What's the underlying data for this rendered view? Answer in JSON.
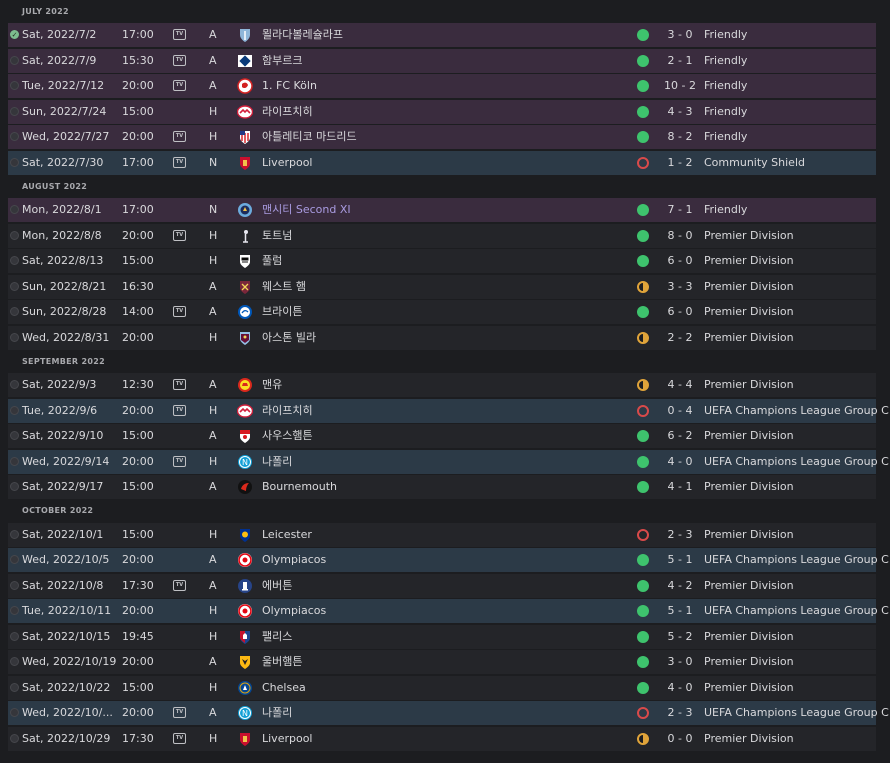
{
  "colors": {
    "background": "#1c1d20",
    "row": "#242529",
    "row_friendly": "#3a2c3e",
    "row_europe": "#2c3a47",
    "win": "#3ec36d",
    "draw": "#e0a43a",
    "loss": "#d94a4a",
    "accent_link": "#a99be0"
  },
  "tv_label": "TV",
  "months": [
    {
      "label": "JULY 2022",
      "matches": [
        {
          "date": "Sat, 2022/7/2",
          "time": "17:00",
          "tv": true,
          "venue": "A",
          "crest": "crest-malmo-icon",
          "opponent": "묄라다볼레슐라프",
          "result": "win",
          "score": "3 - 0",
          "competition": "Friendly",
          "kind": "friendly",
          "check": "done"
        },
        {
          "date": "Sat, 2022/7/9",
          "time": "15:30",
          "tv": true,
          "venue": "A",
          "crest": "crest-hamburg-icon",
          "opponent": "함부르크",
          "result": "win",
          "score": "2 - 1",
          "competition": "Friendly",
          "kind": "friendly",
          "check": "empty"
        },
        {
          "date": "Tue, 2022/7/12",
          "time": "20:00",
          "tv": true,
          "venue": "A",
          "crest": "crest-koln-icon",
          "opponent": "1. FC Köln",
          "result": "win",
          "score": "10 - 2",
          "competition": "Friendly",
          "kind": "friendly",
          "check": "empty"
        },
        {
          "date": "Sun, 2022/7/24",
          "time": "15:00",
          "tv": false,
          "venue": "H",
          "crest": "crest-leipzig-icon",
          "opponent": "라이프치히",
          "result": "win",
          "score": "4 - 3",
          "competition": "Friendly",
          "kind": "friendly",
          "check": "empty"
        },
        {
          "date": "Wed, 2022/7/27",
          "time": "20:00",
          "tv": true,
          "venue": "H",
          "crest": "crest-atletico-icon",
          "opponent": "아틀레티코 마드리드",
          "result": "win",
          "score": "8 - 2",
          "competition": "Friendly",
          "kind": "friendly",
          "check": "empty"
        },
        {
          "date": "Sat, 2022/7/30",
          "time": "17:00",
          "tv": true,
          "venue": "N",
          "crest": "crest-liverpool-icon",
          "opponent": "Liverpool",
          "result": "loss",
          "score": "1 - 2",
          "competition": "Community Shield",
          "kind": "europe",
          "check": "empty"
        }
      ]
    },
    {
      "label": "AUGUST 2022",
      "matches": [
        {
          "date": "Mon, 2022/8/1",
          "time": "17:00",
          "tv": false,
          "venue": "N",
          "crest": "crest-mancity-icon",
          "opponent": "맨시티 Second XI",
          "result": "win",
          "score": "7 - 1",
          "competition": "Friendly",
          "kind": "friendly",
          "check": "empty",
          "special": true
        },
        {
          "date": "Mon, 2022/8/8",
          "time": "20:00",
          "tv": true,
          "venue": "H",
          "crest": "crest-tottenham-icon",
          "opponent": "토트넘",
          "result": "win",
          "score": "8 - 0",
          "competition": "Premier Division",
          "kind": "league",
          "check": "empty"
        },
        {
          "date": "Sat, 2022/8/13",
          "time": "15:00",
          "tv": false,
          "venue": "H",
          "crest": "crest-fulham-icon",
          "opponent": "풀럼",
          "result": "win",
          "score": "6 - 0",
          "competition": "Premier Division",
          "kind": "league",
          "check": "empty"
        },
        {
          "date": "Sun, 2022/8/21",
          "time": "16:30",
          "tv": false,
          "venue": "A",
          "crest": "crest-westham-icon",
          "opponent": "웨스트 햄",
          "result": "draw",
          "score": "3 - 3",
          "competition": "Premier Division",
          "kind": "league",
          "check": "empty"
        },
        {
          "date": "Sun, 2022/8/28",
          "time": "14:00",
          "tv": true,
          "venue": "A",
          "crest": "crest-brighton-icon",
          "opponent": "브라이튼",
          "result": "win",
          "score": "6 - 0",
          "competition": "Premier Division",
          "kind": "league",
          "check": "empty"
        },
        {
          "date": "Wed, 2022/8/31",
          "time": "20:00",
          "tv": false,
          "venue": "H",
          "crest": "crest-villa-icon",
          "opponent": "아스톤 빌라",
          "result": "draw",
          "score": "2 - 2",
          "competition": "Premier Division",
          "kind": "league",
          "check": "empty"
        }
      ]
    },
    {
      "label": "SEPTEMBER 2022",
      "matches": [
        {
          "date": "Sat, 2022/9/3",
          "time": "12:30",
          "tv": true,
          "venue": "A",
          "crest": "crest-manutd-icon",
          "opponent": "맨유",
          "result": "draw",
          "score": "4 - 4",
          "competition": "Premier Division",
          "kind": "league",
          "check": "empty"
        },
        {
          "date": "Tue, 2022/9/6",
          "time": "20:00",
          "tv": true,
          "venue": "H",
          "crest": "crest-leipzig-icon",
          "opponent": "라이프치히",
          "result": "loss",
          "score": "0 - 4",
          "competition": "UEFA Champions League Group C",
          "kind": "europe",
          "check": "empty"
        },
        {
          "date": "Sat, 2022/9/10",
          "time": "15:00",
          "tv": false,
          "venue": "A",
          "crest": "crest-southampton-icon",
          "opponent": "사우스햄튼",
          "result": "win",
          "score": "6 - 2",
          "competition": "Premier Division",
          "kind": "league",
          "check": "empty"
        },
        {
          "date": "Wed, 2022/9/14",
          "time": "20:00",
          "tv": true,
          "venue": "H",
          "crest": "crest-napoli-icon",
          "opponent": "나폴리",
          "result": "win",
          "score": "4 - 0",
          "competition": "UEFA Champions League Group C",
          "kind": "europe",
          "check": "empty"
        },
        {
          "date": "Sat, 2022/9/17",
          "time": "15:00",
          "tv": false,
          "venue": "A",
          "crest": "crest-bournemouth-icon",
          "opponent": "Bournemouth",
          "result": "win",
          "score": "4 - 1",
          "competition": "Premier Division",
          "kind": "league",
          "check": "empty"
        }
      ]
    },
    {
      "label": "OCTOBER 2022",
      "matches": [
        {
          "date": "Sat, 2022/10/1",
          "time": "15:00",
          "tv": false,
          "venue": "H",
          "crest": "crest-leicester-icon",
          "opponent": "Leicester",
          "result": "loss",
          "score": "2 - 3",
          "competition": "Premier Division",
          "kind": "league",
          "check": "empty"
        },
        {
          "date": "Wed, 2022/10/5",
          "time": "20:00",
          "tv": false,
          "venue": "A",
          "crest": "crest-olympiacos-icon",
          "opponent": "Olympiacos",
          "result": "win",
          "score": "5 - 1",
          "competition": "UEFA Champions League Group C",
          "kind": "europe",
          "check": "empty"
        },
        {
          "date": "Sat, 2022/10/8",
          "time": "17:30",
          "tv": true,
          "venue": "A",
          "crest": "crest-everton-icon",
          "opponent": "에버튼",
          "result": "win",
          "score": "4 - 2",
          "competition": "Premier Division",
          "kind": "league",
          "check": "empty"
        },
        {
          "date": "Tue, 2022/10/11",
          "time": "20:00",
          "tv": false,
          "venue": "H",
          "crest": "crest-olympiacos-icon",
          "opponent": "Olympiacos",
          "result": "win",
          "score": "5 - 1",
          "competition": "UEFA Champions League Group C",
          "kind": "europe",
          "check": "empty"
        },
        {
          "date": "Sat, 2022/10/15",
          "time": "19:45",
          "tv": false,
          "venue": "H",
          "crest": "crest-palace-icon",
          "opponent": "팰리스",
          "result": "win",
          "score": "5 - 2",
          "competition": "Premier Division",
          "kind": "league",
          "check": "empty"
        },
        {
          "date": "Wed, 2022/10/19",
          "time": "20:00",
          "tv": false,
          "venue": "A",
          "crest": "crest-wolves-icon",
          "opponent": "울버햄튼",
          "result": "win",
          "score": "3 - 0",
          "competition": "Premier Division",
          "kind": "league",
          "check": "empty"
        },
        {
          "date": "Sat, 2022/10/22",
          "time": "15:00",
          "tv": false,
          "venue": "H",
          "crest": "crest-chelsea-icon",
          "opponent": "Chelsea",
          "result": "win",
          "score": "4 - 0",
          "competition": "Premier Division",
          "kind": "league",
          "check": "empty"
        },
        {
          "date": "Wed, 2022/10/...",
          "time": "20:00",
          "tv": true,
          "venue": "A",
          "crest": "crest-napoli-icon",
          "opponent": "나폴리",
          "result": "loss",
          "score": "2 - 3",
          "competition": "UEFA Champions League Group C",
          "kind": "europe",
          "check": "empty"
        },
        {
          "date": "Sat, 2022/10/29",
          "time": "17:30",
          "tv": true,
          "venue": "H",
          "crest": "crest-liverpool-icon",
          "opponent": "Liverpool",
          "result": "draw",
          "score": "0 - 0",
          "competition": "Premier Division",
          "kind": "league",
          "check": "empty"
        }
      ]
    }
  ]
}
